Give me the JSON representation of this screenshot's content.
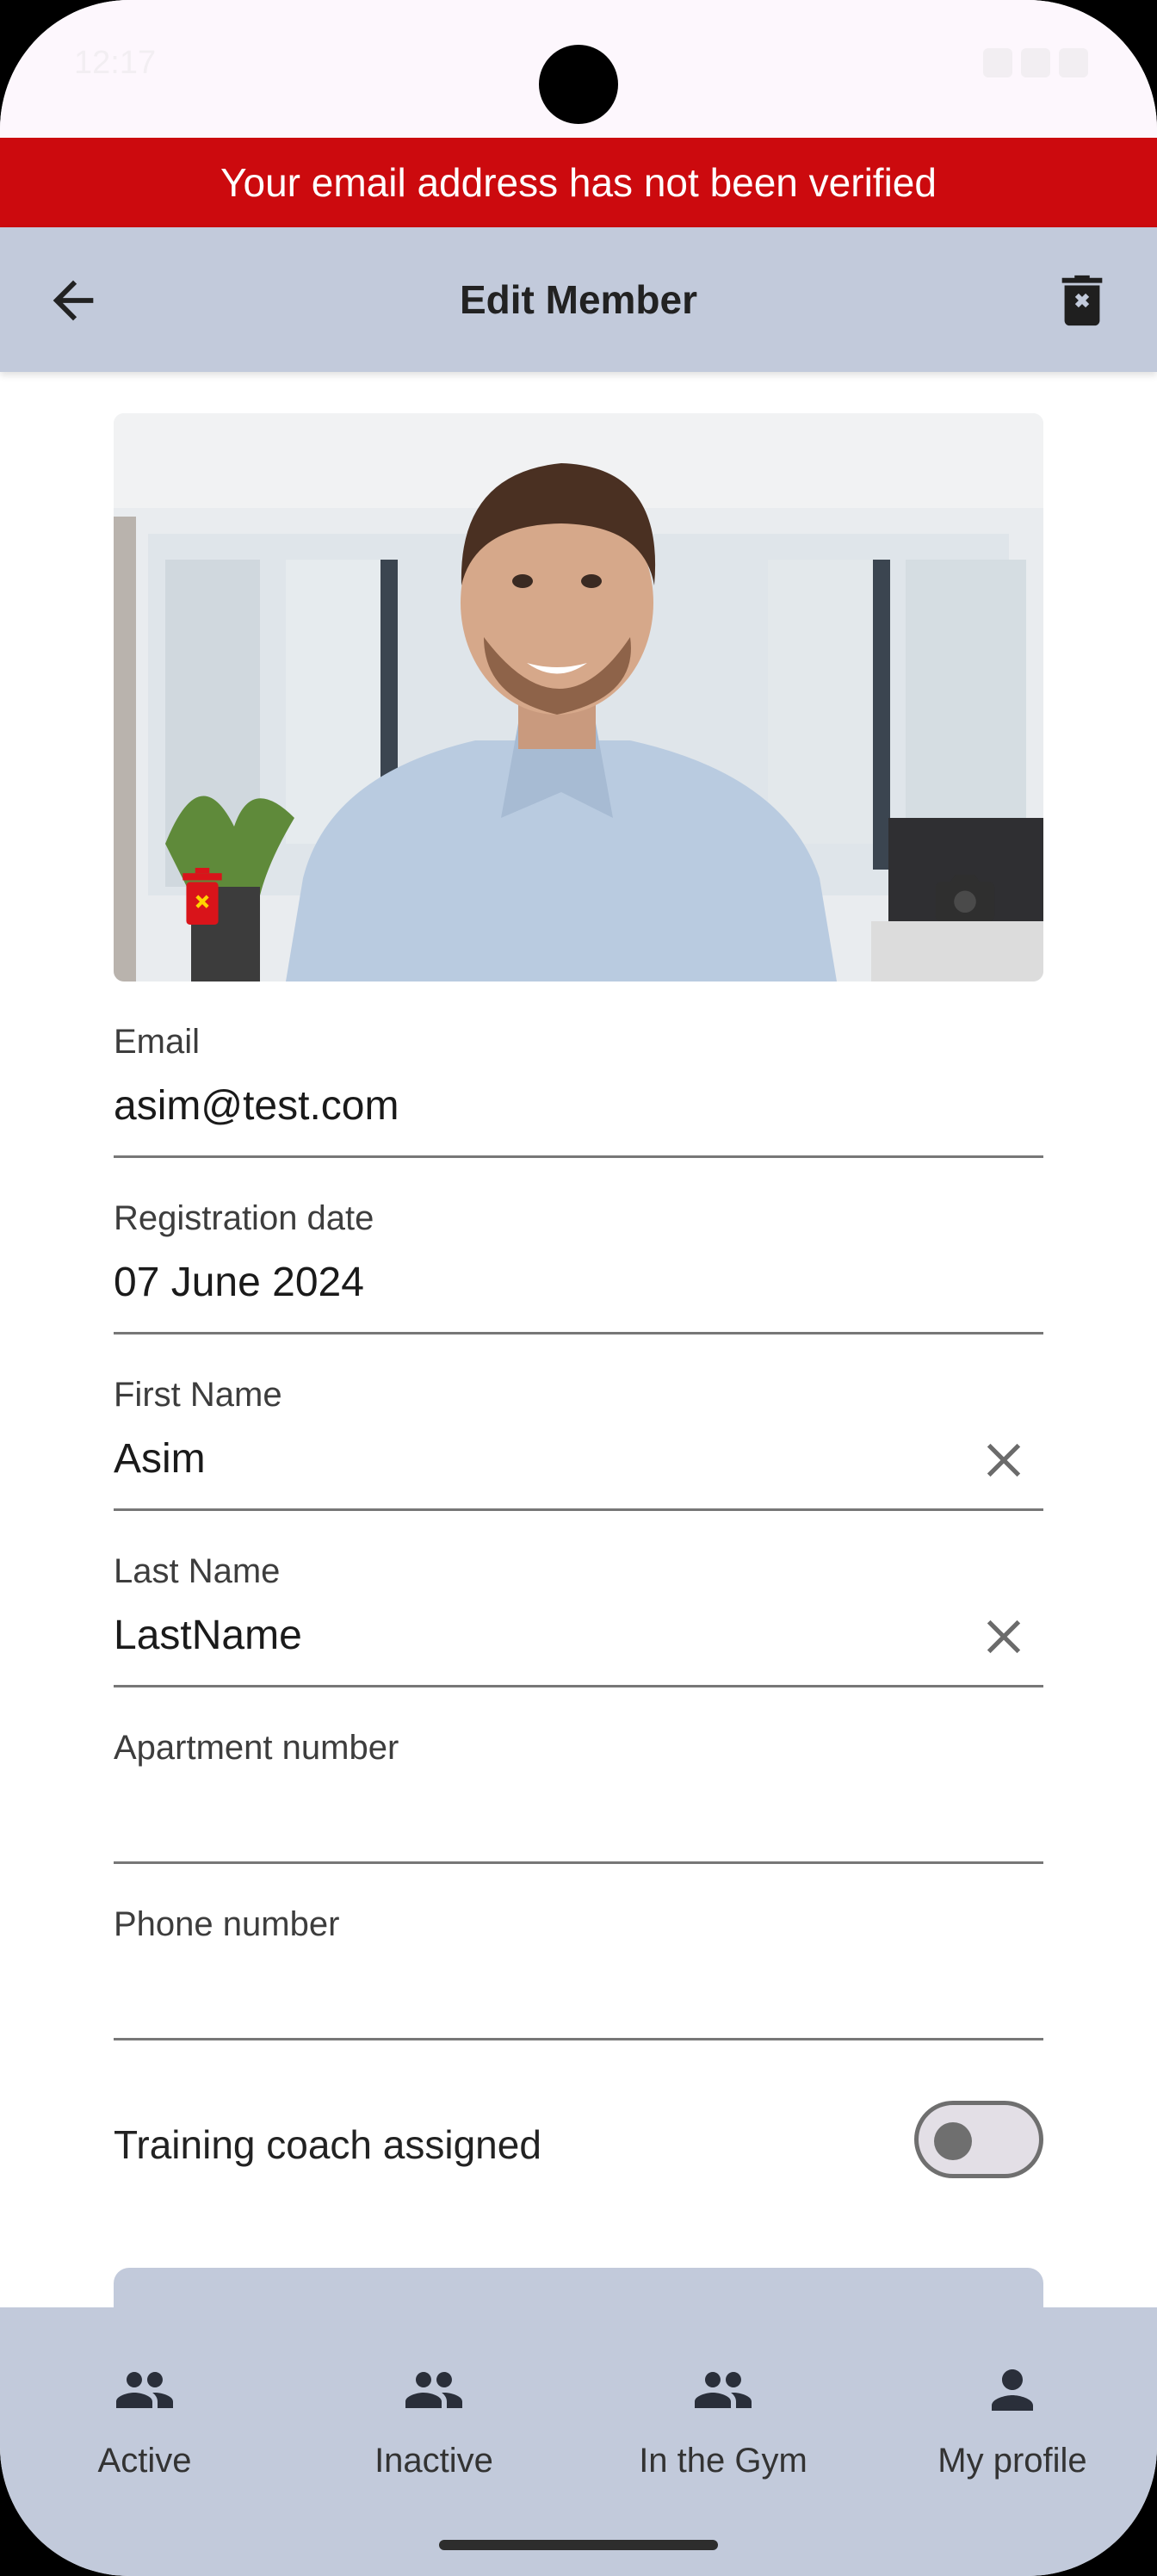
{
  "status_bar": {
    "time": "12:17"
  },
  "banner": {
    "text": "Your email address has not been verified"
  },
  "appbar": {
    "title": "Edit Member"
  },
  "form": {
    "email": {
      "label": "Email",
      "value": "asim@test.com"
    },
    "registration_date": {
      "label": "Registration date",
      "value": "07 June 2024"
    },
    "first_name": {
      "label": "First Name",
      "value": "Asim"
    },
    "last_name": {
      "label": "Last Name",
      "value": "LastName"
    },
    "apartment": {
      "label": "Apartment number",
      "value": ""
    },
    "phone": {
      "label": "Phone number",
      "value": ""
    },
    "coach": {
      "label": "Training coach assigned",
      "enabled": false
    }
  },
  "bottom_nav": {
    "items": [
      {
        "label": "Active",
        "icon": "people-icon"
      },
      {
        "label": "Inactive",
        "icon": "people-icon"
      },
      {
        "label": "In the Gym",
        "icon": "people-icon"
      },
      {
        "label": "My profile",
        "icon": "person-icon"
      }
    ]
  },
  "colors": {
    "banner": "#cc0a0e",
    "appbar": "#c2cadb",
    "status_bar": "#fdf7fd",
    "photo_delete": "#d9141a"
  }
}
